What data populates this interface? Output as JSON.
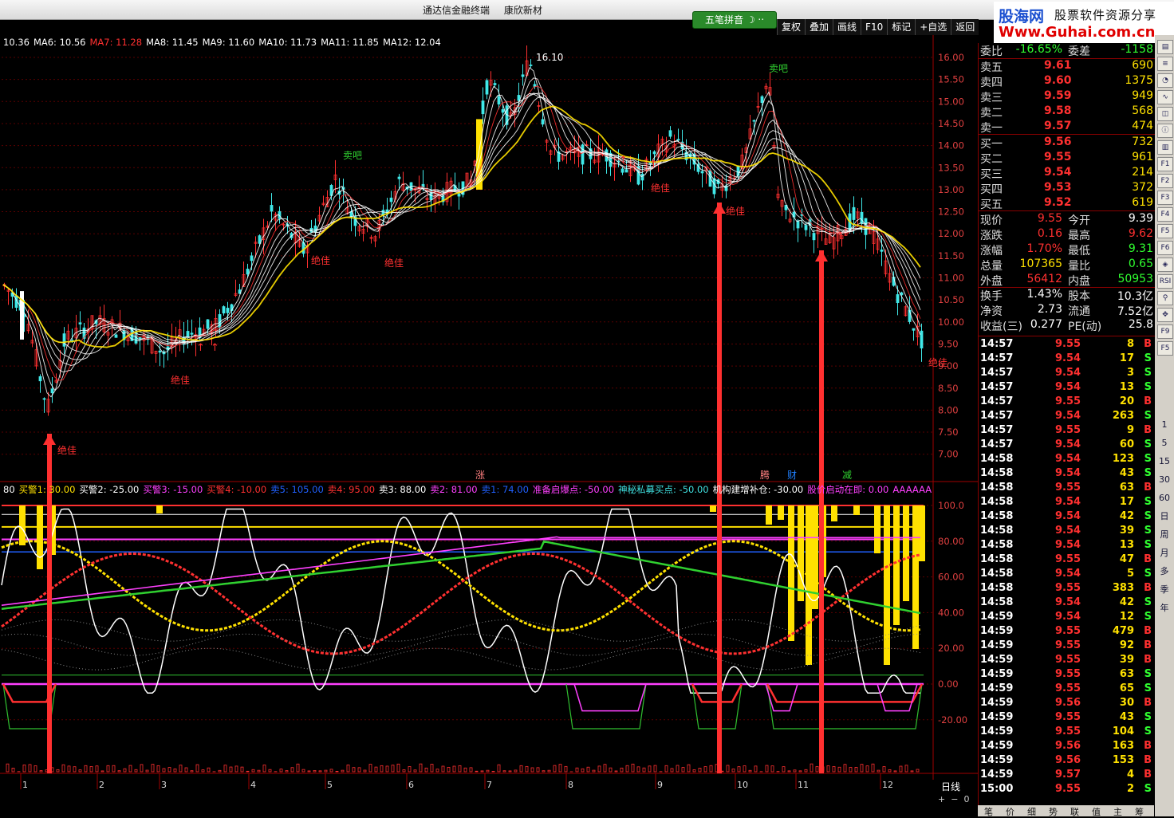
{
  "window": {
    "title_parts": [
      "通达信金融终端",
      "康欣新材"
    ]
  },
  "watermark": {
    "logo": "股海网",
    "tagline": "股票软件资源分享",
    "url": "Www.Guhai.com.cn"
  },
  "input_method": {
    "label": "五笔拼音"
  },
  "toolbar": [
    "复权",
    "叠加",
    "画线",
    "F10",
    "标记",
    "+自选",
    "返回"
  ],
  "ma_legend": [
    {
      "text": "10.36",
      "color": "#ffffff"
    },
    {
      "text": "MA6: 10.56",
      "color": "#ffffff"
    },
    {
      "text": "MA7: 11.28",
      "color": "#ff3030"
    },
    {
      "text": "MA8: 11.45",
      "color": "#ffffff"
    },
    {
      "text": "MA9: 11.60",
      "color": "#ffffff"
    },
    {
      "text": "MA10: 11.73",
      "color": "#ffffff"
    },
    {
      "text": "MA11: 11.85",
      "color": "#ffffff"
    },
    {
      "text": "MA12: 12.04",
      "color": "#ffffff"
    }
  ],
  "indicator_legend": [
    {
      "text": "80",
      "color": "#ffffff"
    },
    {
      "text": "买警1: 30.00",
      "color": "#ffe100"
    },
    {
      "text": "买警2: -25.00",
      "color": "#ffffff"
    },
    {
      "text": "买警3: -15.00",
      "color": "#ff40ff"
    },
    {
      "text": "买警4: -10.00",
      "color": "#ff3030"
    },
    {
      "text": "卖5: 105.00",
      "color": "#2060ff"
    },
    {
      "text": "卖4: 95.00",
      "color": "#ff3030"
    },
    {
      "text": "卖3: 88.00",
      "color": "#ffffff"
    },
    {
      "text": "卖2: 81.00",
      "color": "#ff40ff"
    },
    {
      "text": "卖1: 74.00",
      "color": "#2060ff"
    },
    {
      "text": "准备启爆点: -50.00",
      "color": "#ff40ff"
    },
    {
      "text": "神秘私募买点: -50.00",
      "color": "#40e0e0"
    },
    {
      "text": "机构建增补仓: -30.00",
      "color": "#ffffff"
    },
    {
      "text": "股价启动在即: 0.00",
      "color": "#ff40ff"
    },
    {
      "text": "AAAAAA",
      "color": "#ff40ff"
    }
  ],
  "price_axis": [
    "16.00",
    "15.50",
    "15.00",
    "14.50",
    "14.00",
    "13.50",
    "13.00",
    "12.50",
    "12.00",
    "11.50",
    "11.00",
    "10.50",
    "10.00",
    "9.50",
    "9.00",
    "8.50",
    "8.00",
    "7.50",
    "7.00"
  ],
  "indicator_axis": [
    "100.0",
    "80.00",
    "60.00",
    "40.00",
    "20.00",
    "0.00",
    "-20.00"
  ],
  "x_axis": [
    "1",
    "2",
    "3",
    "4",
    "5",
    "6",
    "7",
    "8",
    "9",
    "10",
    "11",
    "12"
  ],
  "day_label": "日线",
  "annotations": {
    "high": "16.10",
    "sell": "卖吧",
    "best": "绝佳",
    "zhang": "涨",
    "teng": "腾",
    "cai": "财",
    "jian": "减"
  },
  "quote": {
    "weibi": {
      "label": "委比",
      "value": "-16.65%",
      "label2": "委差",
      "value2": "-1158"
    },
    "asks": [
      {
        "label": "卖五",
        "price": "9.61",
        "vol": "690"
      },
      {
        "label": "卖四",
        "price": "9.60",
        "vol": "1375"
      },
      {
        "label": "卖三",
        "price": "9.59",
        "vol": "949"
      },
      {
        "label": "卖二",
        "price": "9.58",
        "vol": "568"
      },
      {
        "label": "卖一",
        "price": "9.57",
        "vol": "474"
      }
    ],
    "bids": [
      {
        "label": "买一",
        "price": "9.56",
        "vol": "732"
      },
      {
        "label": "买二",
        "price": "9.55",
        "vol": "961"
      },
      {
        "label": "买三",
        "price": "9.54",
        "vol": "214"
      },
      {
        "label": "买四",
        "price": "9.53",
        "vol": "372"
      },
      {
        "label": "买五",
        "price": "9.52",
        "vol": "619"
      }
    ],
    "stats": [
      {
        "l1": "现价",
        "v1": "9.55",
        "c1": "#ff3030",
        "l2": "今开",
        "v2": "9.39",
        "c2": "#ffffff"
      },
      {
        "l1": "涨跌",
        "v1": "0.16",
        "c1": "#ff3030",
        "l2": "最高",
        "v2": "9.62",
        "c2": "#ff3030"
      },
      {
        "l1": "涨幅",
        "v1": "1.70%",
        "c1": "#ff3030",
        "l2": "最低",
        "v2": "9.31",
        "c2": "#30ff30"
      },
      {
        "l1": "总量",
        "v1": "107365",
        "c1": "#ffe100",
        "l2": "量比",
        "v2": "0.65",
        "c2": "#30ff30"
      },
      {
        "l1": "外盘",
        "v1": "56412",
        "c1": "#ff3030",
        "l2": "内盘",
        "v2": "50953",
        "c2": "#30ff30"
      },
      {
        "l1": "换手",
        "v1": "1.43%",
        "c1": "#ffffff",
        "l2": "股本",
        "v2": "10.3亿",
        "c2": "#ffffff"
      },
      {
        "l1": "净资",
        "v1": "2.73",
        "c1": "#ffffff",
        "l2": "流通",
        "v2": "7.52亿",
        "c2": "#ffffff"
      },
      {
        "l1": "收益(三)",
        "v1": "0.277",
        "c1": "#ffffff",
        "l2": "PE(动)",
        "v2": "25.8",
        "c2": "#ffffff"
      }
    ]
  },
  "ticks": [
    {
      "t": "14:57",
      "p": "9.55",
      "v": "8",
      "s": "B"
    },
    {
      "t": "14:57",
      "p": "9.54",
      "v": "17",
      "s": "S"
    },
    {
      "t": "14:57",
      "p": "9.54",
      "v": "3",
      "s": "S"
    },
    {
      "t": "14:57",
      "p": "9.54",
      "v": "13",
      "s": "S"
    },
    {
      "t": "14:57",
      "p": "9.55",
      "v": "20",
      "s": "B"
    },
    {
      "t": "14:57",
      "p": "9.54",
      "v": "263",
      "s": "S"
    },
    {
      "t": "14:57",
      "p": "9.55",
      "v": "9",
      "s": "B"
    },
    {
      "t": "14:57",
      "p": "9.54",
      "v": "60",
      "s": "S"
    },
    {
      "t": "14:58",
      "p": "9.54",
      "v": "123",
      "s": "S"
    },
    {
      "t": "14:58",
      "p": "9.54",
      "v": "43",
      "s": "S"
    },
    {
      "t": "14:58",
      "p": "9.55",
      "v": "63",
      "s": "B"
    },
    {
      "t": "14:58",
      "p": "9.54",
      "v": "17",
      "s": "S"
    },
    {
      "t": "14:58",
      "p": "9.54",
      "v": "42",
      "s": "S"
    },
    {
      "t": "14:58",
      "p": "9.54",
      "v": "39",
      "s": "S"
    },
    {
      "t": "14:58",
      "p": "9.54",
      "v": "13",
      "s": "S"
    },
    {
      "t": "14:58",
      "p": "9.55",
      "v": "47",
      "s": "B"
    },
    {
      "t": "14:58",
      "p": "9.54",
      "v": "5",
      "s": "S"
    },
    {
      "t": "14:58",
      "p": "9.55",
      "v": "383",
      "s": "B"
    },
    {
      "t": "14:58",
      "p": "9.54",
      "v": "42",
      "s": "S"
    },
    {
      "t": "14:59",
      "p": "9.54",
      "v": "12",
      "s": "S"
    },
    {
      "t": "14:59",
      "p": "9.55",
      "v": "479",
      "s": "B"
    },
    {
      "t": "14:59",
      "p": "9.55",
      "v": "92",
      "s": "B"
    },
    {
      "t": "14:59",
      "p": "9.55",
      "v": "39",
      "s": "B"
    },
    {
      "t": "14:59",
      "p": "9.55",
      "v": "63",
      "s": "S"
    },
    {
      "t": "14:59",
      "p": "9.55",
      "v": "65",
      "s": "S"
    },
    {
      "t": "14:59",
      "p": "9.56",
      "v": "30",
      "s": "B"
    },
    {
      "t": "14:59",
      "p": "9.55",
      "v": "43",
      "s": "S"
    },
    {
      "t": "14:59",
      "p": "9.55",
      "v": "104",
      "s": "S"
    },
    {
      "t": "14:59",
      "p": "9.56",
      "v": "163",
      "s": "B"
    },
    {
      "t": "14:59",
      "p": "9.56",
      "v": "153",
      "s": "B"
    },
    {
      "t": "14:59",
      "p": "9.57",
      "v": "4",
      "s": "B"
    },
    {
      "t": "15:00",
      "p": "9.55",
      "v": "2",
      "s": "S"
    }
  ],
  "period_buttons": [
    "1",
    "5",
    "15",
    "30",
    "60",
    "日",
    "周",
    "月",
    "多",
    "季",
    "年"
  ],
  "bottom_tabs": [
    "笔",
    "价",
    "细",
    "势",
    "联",
    "值",
    "主",
    "筹"
  ]
}
